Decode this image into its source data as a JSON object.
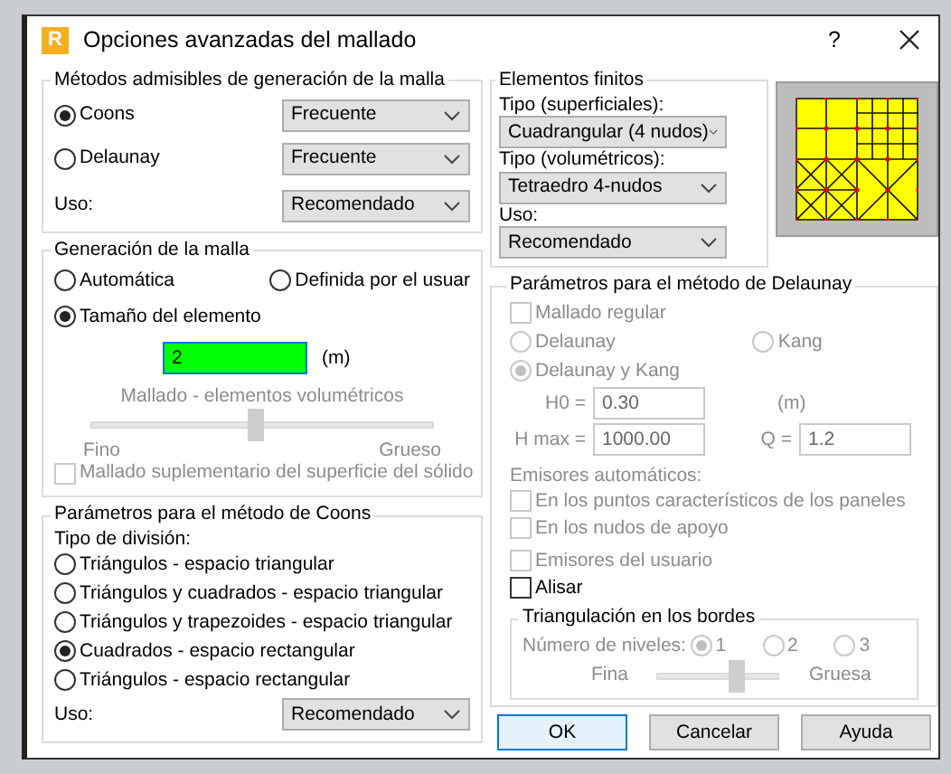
{
  "window": {
    "icon_letter": "R",
    "title": "Opciones avanzadas del mallado",
    "help": "?"
  },
  "methods": {
    "legend": "Métodos admisibles de generación de la malla",
    "options": [
      {
        "label": "Coons",
        "selected": true,
        "value": "Frecuente"
      },
      {
        "label": "Delaunay",
        "selected": false,
        "value": "Frecuente"
      }
    ],
    "uso_label": "Uso:",
    "uso_value": "Recomendado"
  },
  "generation": {
    "legend": "Generación de la malla",
    "options": [
      {
        "label": "Automática",
        "selected": false
      },
      {
        "label": "Definida por el usuar",
        "selected": false
      },
      {
        "label": "Tamaño del elemento",
        "selected": true
      }
    ],
    "size_value": "2",
    "size_unit": "(m)",
    "slider_title": "Mallado - elementos volumétricos",
    "slider_disabled": true,
    "level": 0.48,
    "slider_min": "Fino",
    "slider_max": "Grueso",
    "supplementary": {
      "label": "Mallado suplementario del superficie del sólido",
      "checked": false,
      "disabled": true
    }
  },
  "coons": {
    "legend": "Parámetros para el método de Coons",
    "division_label": "Tipo de división:",
    "options": [
      {
        "label": "Triángulos - espacio triangular",
        "selected": false
      },
      {
        "label": "Triángulos y cuadrados - espacio triangular",
        "selected": false
      },
      {
        "label": "Triángulos y trapezoides - espacio triangular",
        "selected": false
      },
      {
        "label": "Cuadrados - espacio rectangular",
        "selected": true
      },
      {
        "label": "Triángulos - espacio rectangular",
        "selected": false
      }
    ],
    "uso_label": "Uso:",
    "uso_value": "Recomendado"
  },
  "finite_elements": {
    "legend": "Elementos finitos",
    "surface_label": "Tipo (superficiales):",
    "surface_value": "Cuadrangular (4 nudos)",
    "volume_label": "Tipo (volumétricos):",
    "volume_value": "Tetraedro 4-nudos",
    "uso_label": "Uso:",
    "uso_value": "Recomendado"
  },
  "delaunay": {
    "legend": "Parámetros para el método de Delaunay",
    "disabled": true,
    "regular": {
      "label": "Mallado regular",
      "checked": false
    },
    "methods": [
      {
        "label": "Delaunay",
        "selected": false
      },
      {
        "label": "Kang",
        "selected": false
      },
      {
        "label": "Delaunay y Kang",
        "selected": true
      }
    ],
    "h0_label": "H0 =",
    "h0_value": "0.30",
    "h0_unit": "(m)",
    "hmax_label": "H max =",
    "hmax_value": "1000.00",
    "q_label": "Q =",
    "q_value": "1.2",
    "auto_label": "Emisores automáticos:",
    "auto_options": [
      {
        "label": "En los puntos característicos de los paneles",
        "checked": false
      },
      {
        "label": "En los nudos de apoyo",
        "checked": false
      }
    ],
    "user_emitters": {
      "label": "Emisores del usuario",
      "checked": false
    },
    "smooth": {
      "label": "Alisar",
      "checked": false,
      "disabled": false
    },
    "edges": {
      "legend": "Triangulación en los bordes",
      "levels_label": "Número de niveles:",
      "levels": [
        {
          "label": "1",
          "selected": true
        },
        {
          "label": "2",
          "selected": false
        },
        {
          "label": "3",
          "selected": false
        }
      ],
      "slider_min": "Fina",
      "slider_max": "Gruesa",
      "level": 0.65
    }
  },
  "buttons": [
    {
      "label": "OK",
      "default": true
    },
    {
      "label": "Cancelar",
      "default": false
    },
    {
      "label": "Ayuda",
      "default": false
    }
  ]
}
